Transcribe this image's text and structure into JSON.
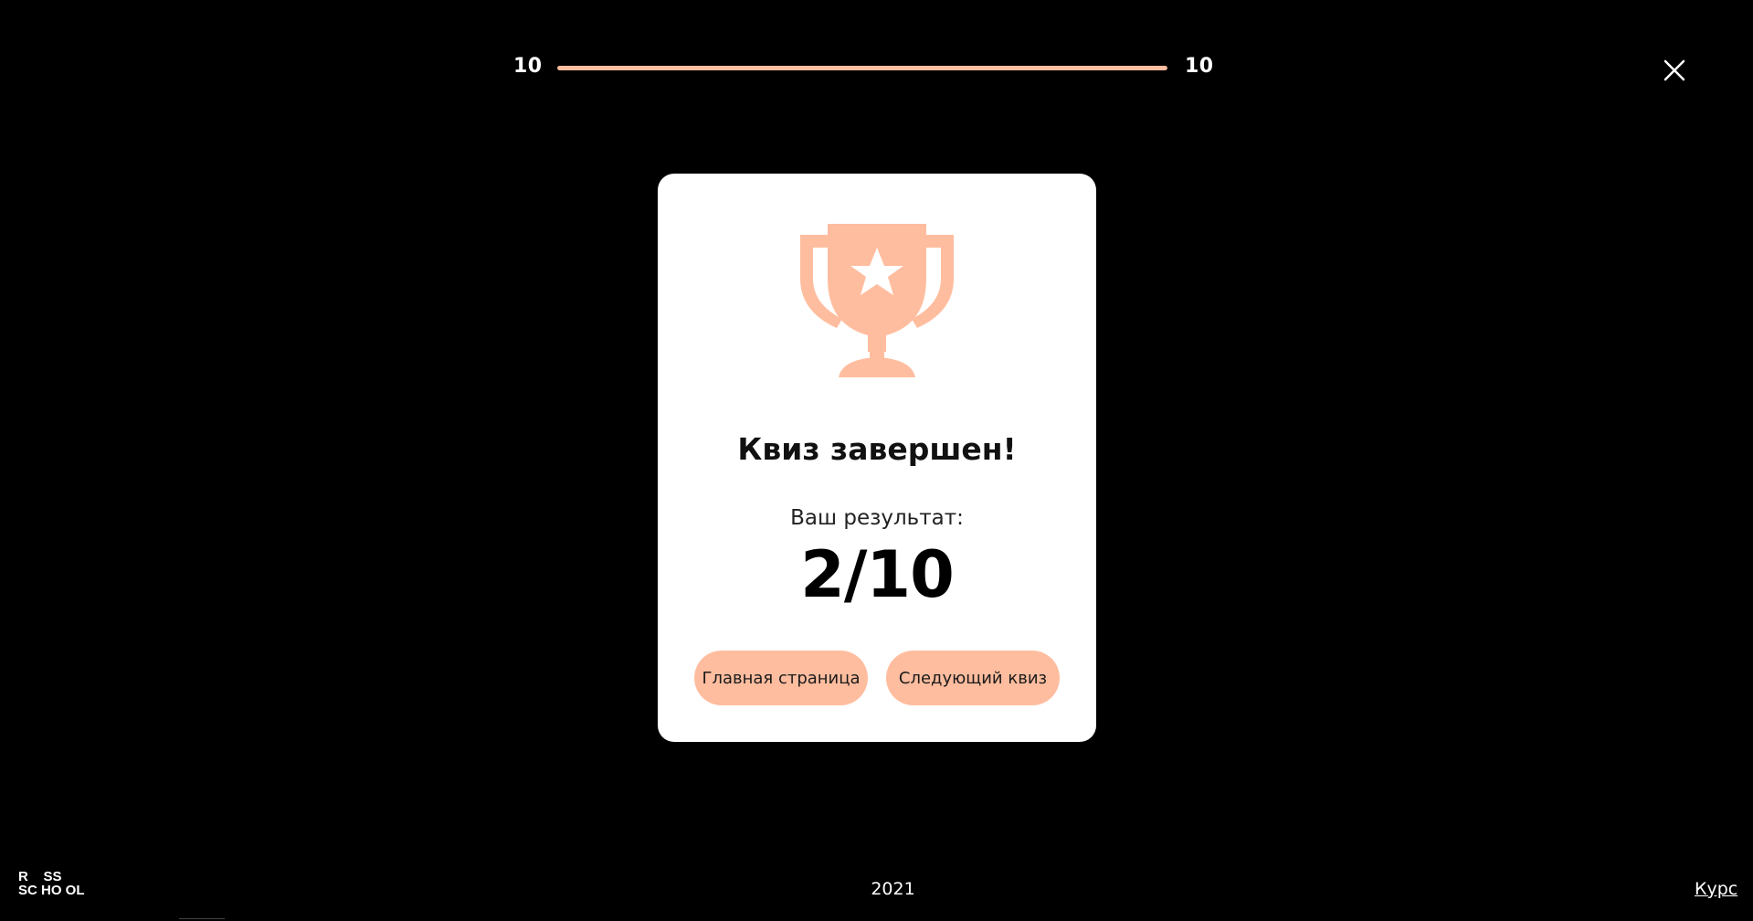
{
  "progress": {
    "current": "10",
    "total": "10",
    "fraction": 1.0,
    "fill_color": "#ffbd9f"
  },
  "close_icon": "close-icon",
  "card": {
    "icon": "trophy-icon",
    "icon_color": "#ffbd9f",
    "title": "Квиз завершен!",
    "result_label": "Ваш результат:",
    "score": "2/10",
    "buttons": {
      "home": "Главная страница",
      "next": "Следующий квиз"
    }
  },
  "footer": {
    "logo_line1": "R    SS",
    "logo_line2": "SC HO OL",
    "year": "2021",
    "course_link": "Курс"
  }
}
